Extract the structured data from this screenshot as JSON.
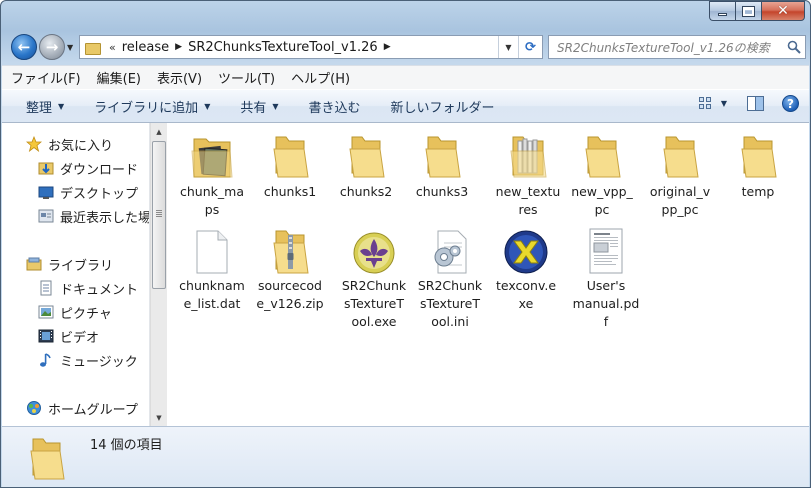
{
  "window": {
    "caption": {
      "minimize": "minimize",
      "maximize": "maximize",
      "close": "close"
    }
  },
  "nav": {
    "address": {
      "overflow": "«",
      "crumbs": [
        "release",
        "SR2ChunksTextureTool_v1.26"
      ]
    },
    "search_placeholder": "SR2ChunksTextureTool_v1.26の検索"
  },
  "menu": [
    "ファイル(F)",
    "編集(E)",
    "表示(V)",
    "ツール(T)",
    "ヘルプ(H)"
  ],
  "toolbar": {
    "organize": "整理",
    "add_to_library": "ライブラリに追加",
    "share": "共有",
    "burn": "書き込む",
    "new_folder": "新しいフォルダー"
  },
  "sidebar": {
    "favorites": "お気に入り",
    "downloads": "ダウンロード",
    "desktop": "デスクトップ",
    "recent": "最近表示した場所",
    "libraries": "ライブラリ",
    "documents": "ドキュメント",
    "pictures": "ピクチャ",
    "videos": "ビデオ",
    "music": "ミュージック",
    "homegroup": "ホームグループ"
  },
  "files": [
    {
      "name": "chunk_maps",
      "label_lines": [
        "chunk_ma",
        "ps"
      ],
      "type": "folder-media"
    },
    {
      "name": "chunks1",
      "label_lines": [
        "chunks1"
      ],
      "type": "folder"
    },
    {
      "name": "chunks2",
      "label_lines": [
        "chunks2"
      ],
      "type": "folder"
    },
    {
      "name": "chunks3",
      "label_lines": [
        "chunks3"
      ],
      "type": "folder"
    },
    {
      "name": "new_textures",
      "label_lines": [
        "new_textu",
        "res"
      ],
      "type": "folder-docs"
    },
    {
      "name": "new_vpp_pc",
      "label_lines": [
        "new_vpp_",
        "pc"
      ],
      "type": "folder"
    },
    {
      "name": "original_vpp_pc",
      "label_lines": [
        "original_v",
        "pp_pc"
      ],
      "type": "folder"
    },
    {
      "name": "temp",
      "label_lines": [
        "temp"
      ],
      "type": "folder"
    },
    {
      "name": "chunkname_list.dat",
      "label_lines": [
        "chunknam",
        "e_list.dat"
      ],
      "type": "blank"
    },
    {
      "name": "sourcecode_v126.zip",
      "label_lines": [
        "sourcecod",
        "e_v126.zip"
      ],
      "type": "zip"
    },
    {
      "name": "SR2ChunksTextureTool.exe",
      "label_lines": [
        "SR2Chunk",
        "sTextureT",
        "ool.exe"
      ],
      "type": "fleur"
    },
    {
      "name": "SR2ChunksTextureTool.ini",
      "label_lines": [
        "SR2Chunk",
        "sTextureT",
        "ool.ini"
      ],
      "type": "ini"
    },
    {
      "name": "texconv.exe",
      "label_lines": [
        "texconv.e",
        "xe"
      ],
      "type": "directx"
    },
    {
      "name": "User's manual.pdf",
      "label_lines": [
        "User's",
        "manual.pd",
        "f"
      ],
      "type": "pdf"
    }
  ],
  "status": {
    "count_text": "14 個の項目"
  },
  "colors": {
    "folder": "#f0d27a",
    "folder_dark": "#c9a443",
    "accent": "#2a76c9",
    "fleur_bg": "#d9cf5a",
    "fleur": "#6a3f8f",
    "directx": "#1f3a8a"
  }
}
